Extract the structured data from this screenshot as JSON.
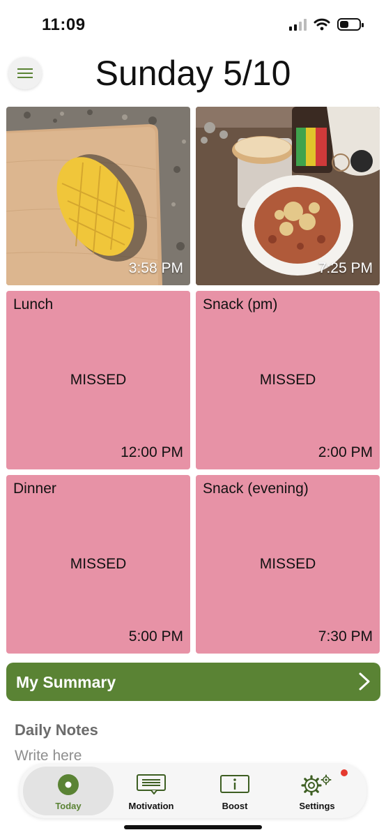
{
  "status_bar": {
    "time": "11:09"
  },
  "header": {
    "title": "Sunday 5/10"
  },
  "photos": [
    {
      "time": "3:58 PM",
      "subject": "mango"
    },
    {
      "time": "7:25 PM",
      "subject": "pasta-bread-drink"
    }
  ],
  "meals": [
    {
      "label": "Lunch",
      "status": "MISSED",
      "time": "12:00 PM"
    },
    {
      "label": "Snack (pm)",
      "status": "MISSED",
      "time": "2:00 PM"
    },
    {
      "label": "Dinner",
      "status": "MISSED",
      "time": "5:00 PM"
    },
    {
      "label": "Snack (evening)",
      "status": "MISSED",
      "time": "7:30 PM"
    }
  ],
  "summary": {
    "label": "My Summary"
  },
  "notes": {
    "title": "Daily Notes",
    "placeholder": "Write here"
  },
  "tabs": [
    {
      "label": "Today",
      "icon": "today-icon",
      "active": true
    },
    {
      "label": "Motivation",
      "icon": "motivation-icon"
    },
    {
      "label": "Boost",
      "icon": "boost-icon"
    },
    {
      "label": "Settings",
      "icon": "settings-icon",
      "badge": true
    }
  ],
  "colors": {
    "accent_green": "#5a8334",
    "missed_pink": "#e792a6",
    "notification_red": "#e53a2f"
  }
}
